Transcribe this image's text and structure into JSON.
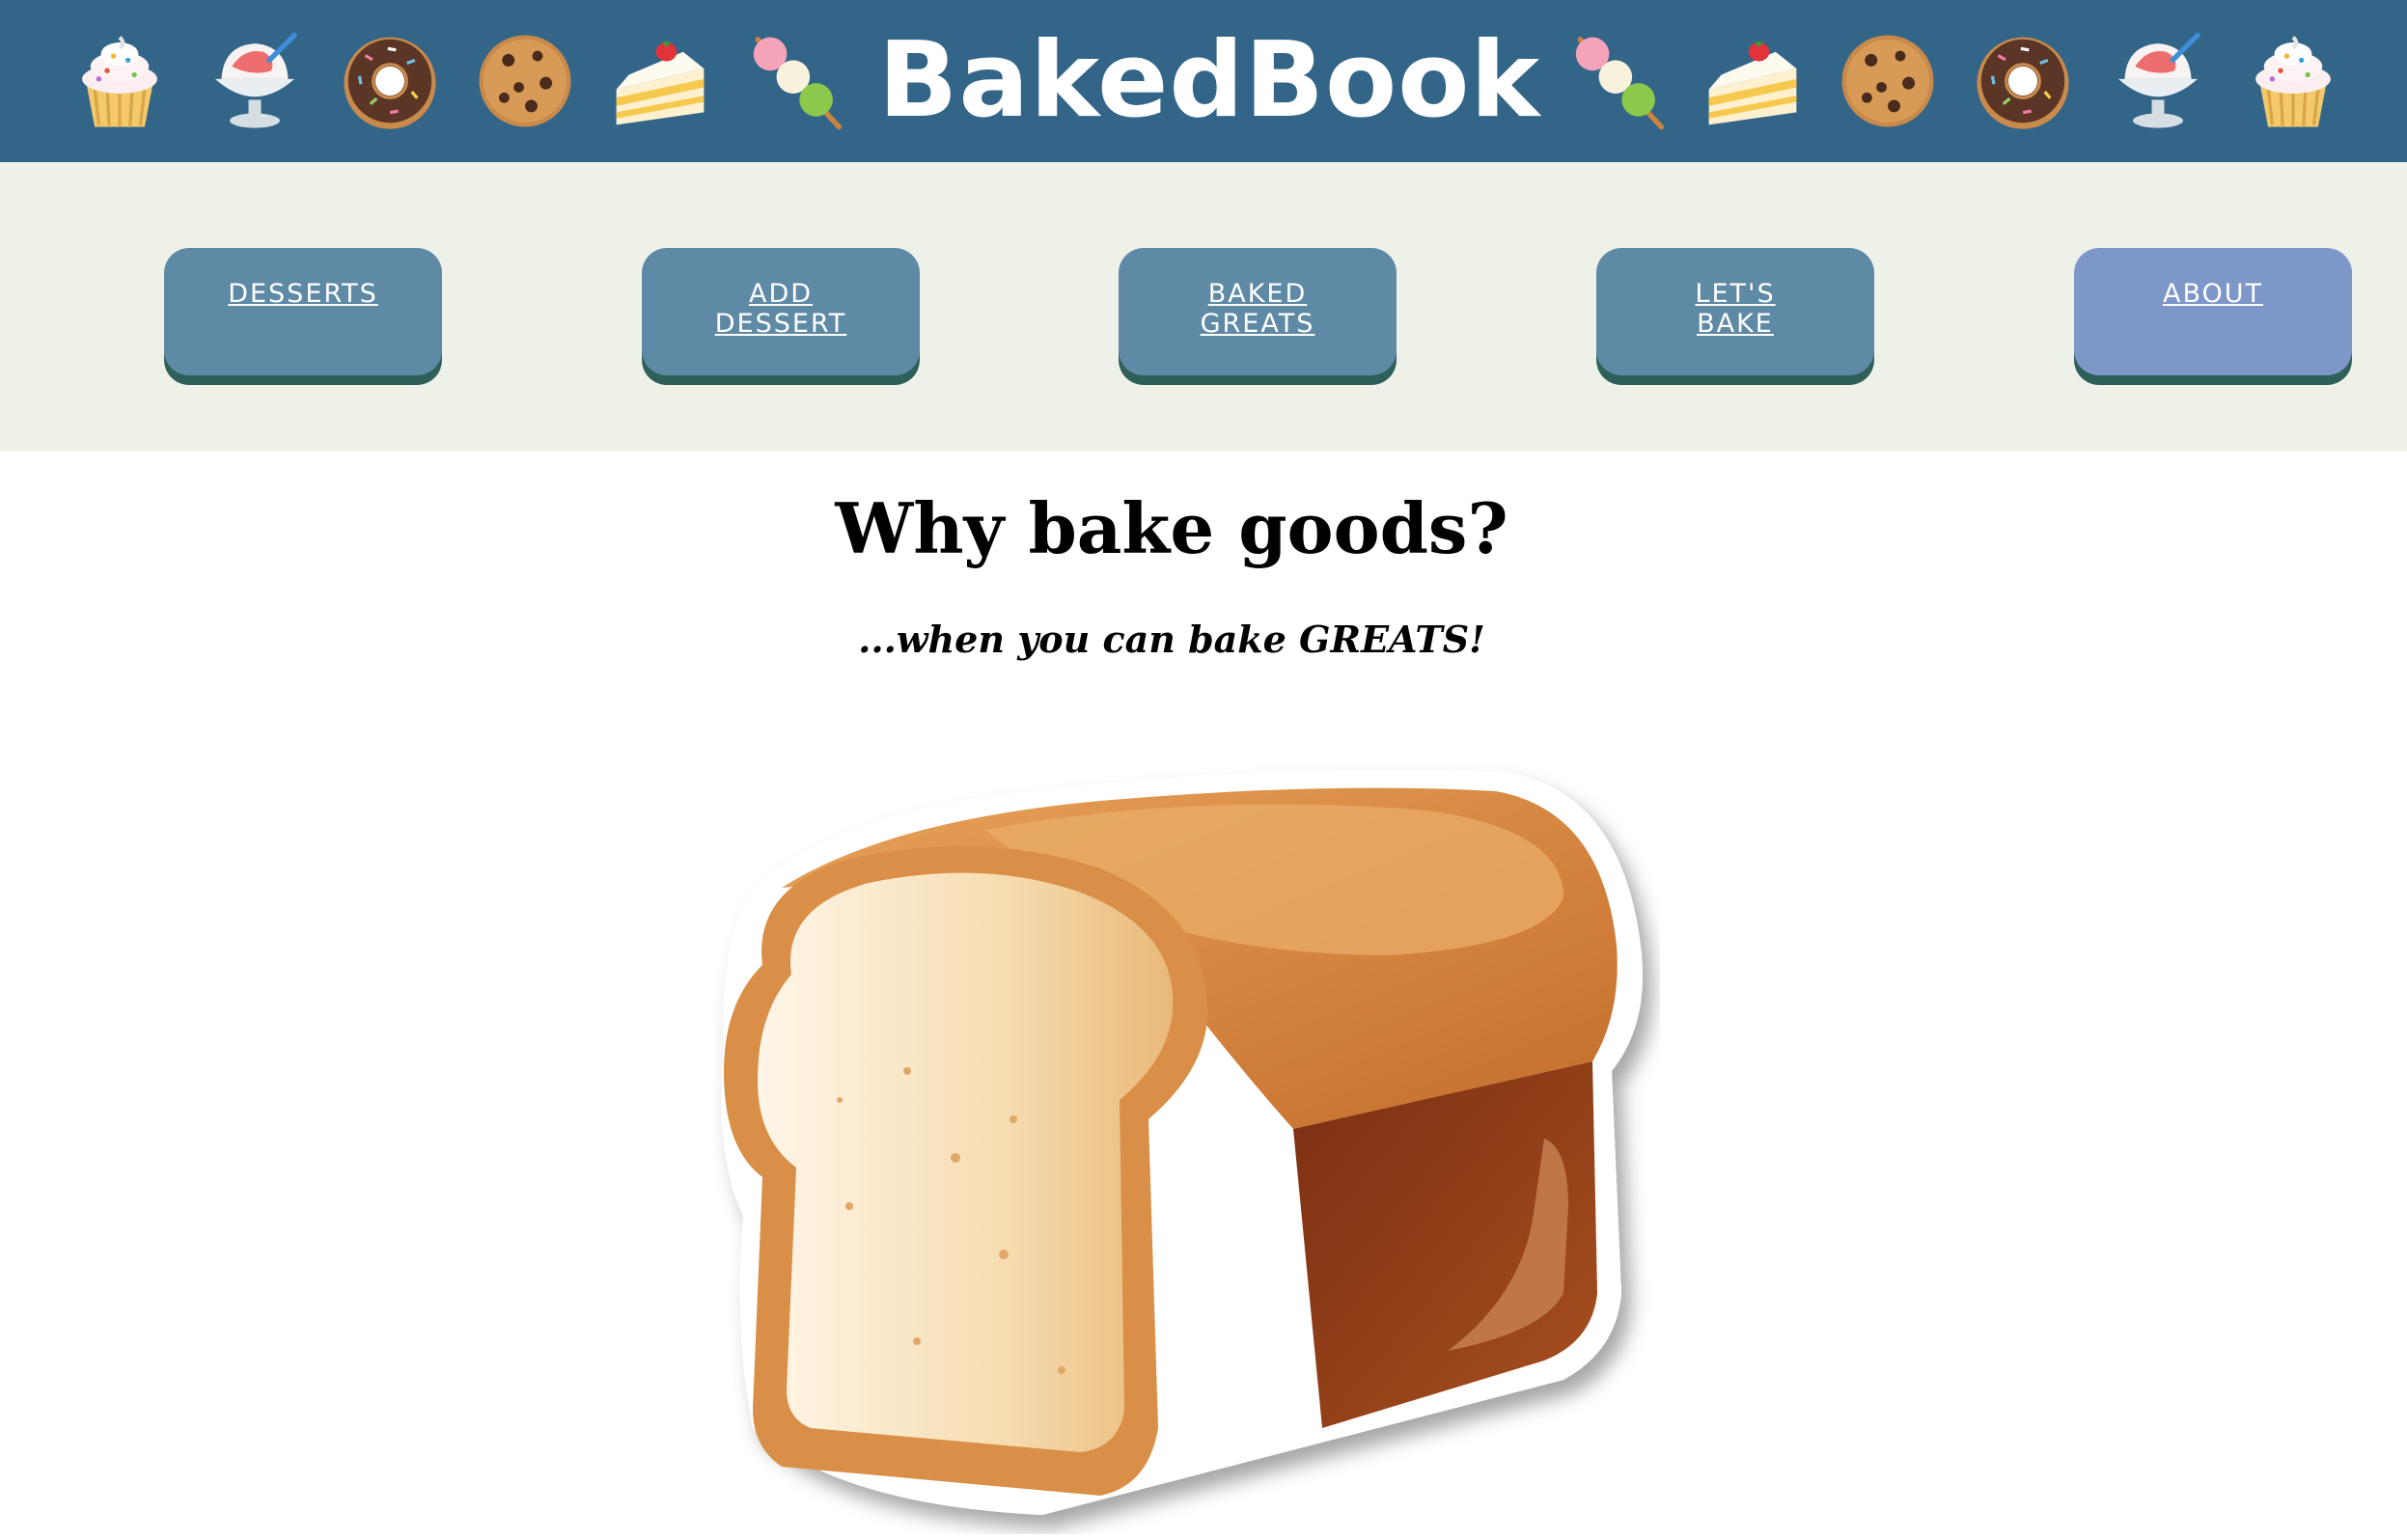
{
  "header": {
    "brand": "BakedBook",
    "left_emojis": [
      "cupcake-icon",
      "shaved-ice-icon",
      "donut-icon",
      "cookie-icon",
      "cake-slice-icon",
      "dango-icon"
    ],
    "right_emojis": [
      "dango-icon",
      "cake-slice-icon",
      "cookie-icon",
      "donut-icon",
      "shaved-ice-icon",
      "cupcake-icon"
    ],
    "background_color": "#336589"
  },
  "nav": {
    "items": [
      {
        "line1": "DESSERTS",
        "line2": ""
      },
      {
        "line1": "ADD",
        "line2": "DESSERT"
      },
      {
        "line1": "BAKED",
        "line2": "GREATS"
      },
      {
        "line1": "LET'S",
        "line2": "BAKE"
      },
      {
        "line1": "ABOUT",
        "line2": ""
      }
    ],
    "button_color": "#5f8aa6",
    "active_button_color": "#7d97c9"
  },
  "main": {
    "title": "Why bake goods?",
    "subtitle": "...when you can bake GREATS!",
    "image": "bread-loaf-image"
  }
}
